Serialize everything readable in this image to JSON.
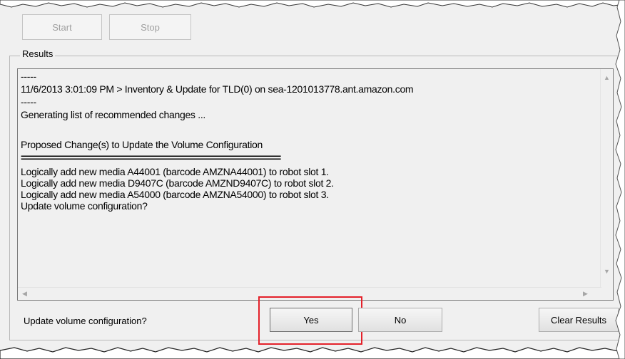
{
  "top_controls": {
    "start_label": "Start",
    "stop_label": "Stop"
  },
  "results": {
    "group_label": "Results",
    "log_lines": [
      "-----",
      "11/6/2013 3:01:09 PM > Inventory & Update for TLD(0) on sea-1201013778.ant.amazon.com",
      "-----",
      "Generating list of recommended changes ...",
      "",
      "Proposed Change(s) to Update the Volume Configuration",
      "=========================================================",
      "Logically add new media A44001 (barcode AMZNA44001) to robot slot 1.",
      "Logically add new media D9407C (barcode AMZND9407C) to robot slot 2.",
      "Logically add new media A54000 (barcode AMZNA54000) to robot slot 3.",
      "Update volume configuration?"
    ]
  },
  "prompt": {
    "question": "Update volume configuration?",
    "yes_label": "Yes",
    "no_label": "No",
    "clear_label": "Clear Results"
  },
  "icons": {
    "scroll_up": "scroll-up-arrow-icon",
    "scroll_down": "scroll-down-arrow-icon",
    "scroll_left": "scroll-left-arrow-icon",
    "scroll_right": "scroll-right-arrow-icon"
  },
  "colors": {
    "highlight": "#e4212a",
    "window_bg": "#f0f0f0"
  }
}
